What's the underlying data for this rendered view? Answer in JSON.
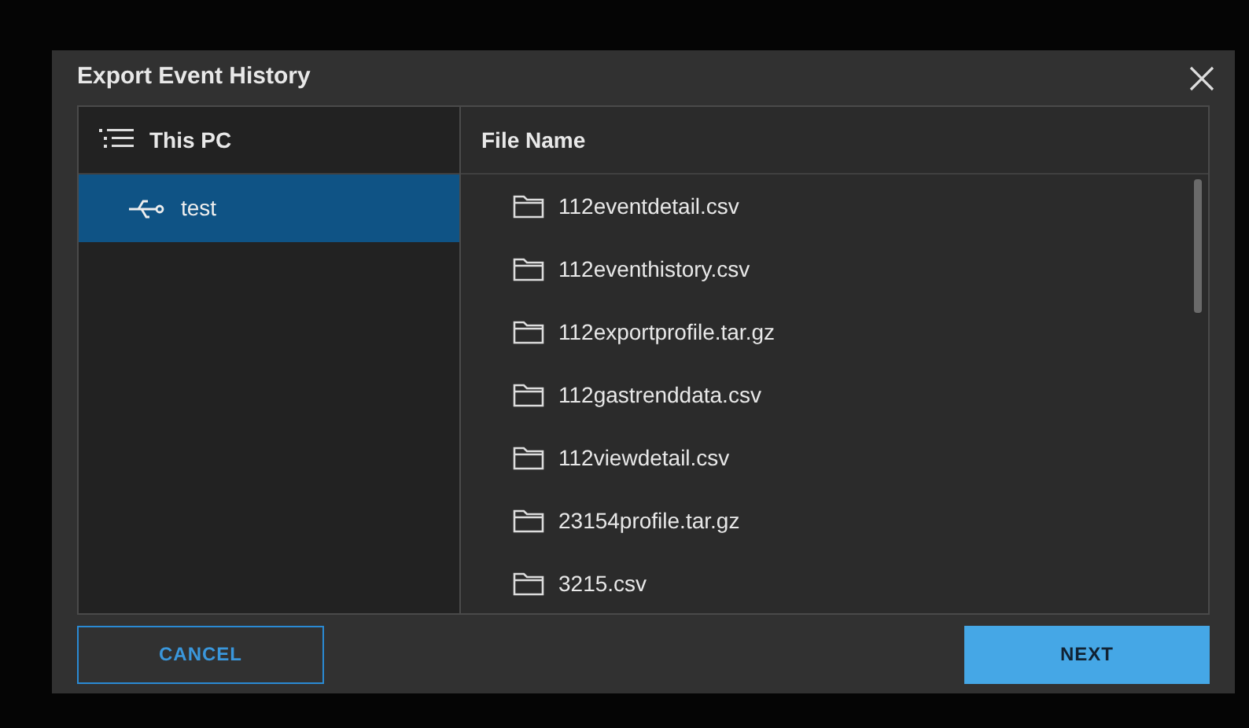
{
  "dialog": {
    "title": "Export Event History"
  },
  "locations": {
    "header": "This PC",
    "items": [
      {
        "label": "test",
        "selected": true
      }
    ]
  },
  "files": {
    "column": "File Name",
    "rows": [
      {
        "name": "112eventdetail.csv"
      },
      {
        "name": "112eventhistory.csv"
      },
      {
        "name": "112exportprofile.tar.gz"
      },
      {
        "name": "112gastrenddata.csv"
      },
      {
        "name": "112viewdetail.csv"
      },
      {
        "name": "23154profile.tar.gz"
      },
      {
        "name": "3215.csv"
      }
    ]
  },
  "buttons": {
    "cancel": "CANCEL",
    "next": "NEXT"
  }
}
